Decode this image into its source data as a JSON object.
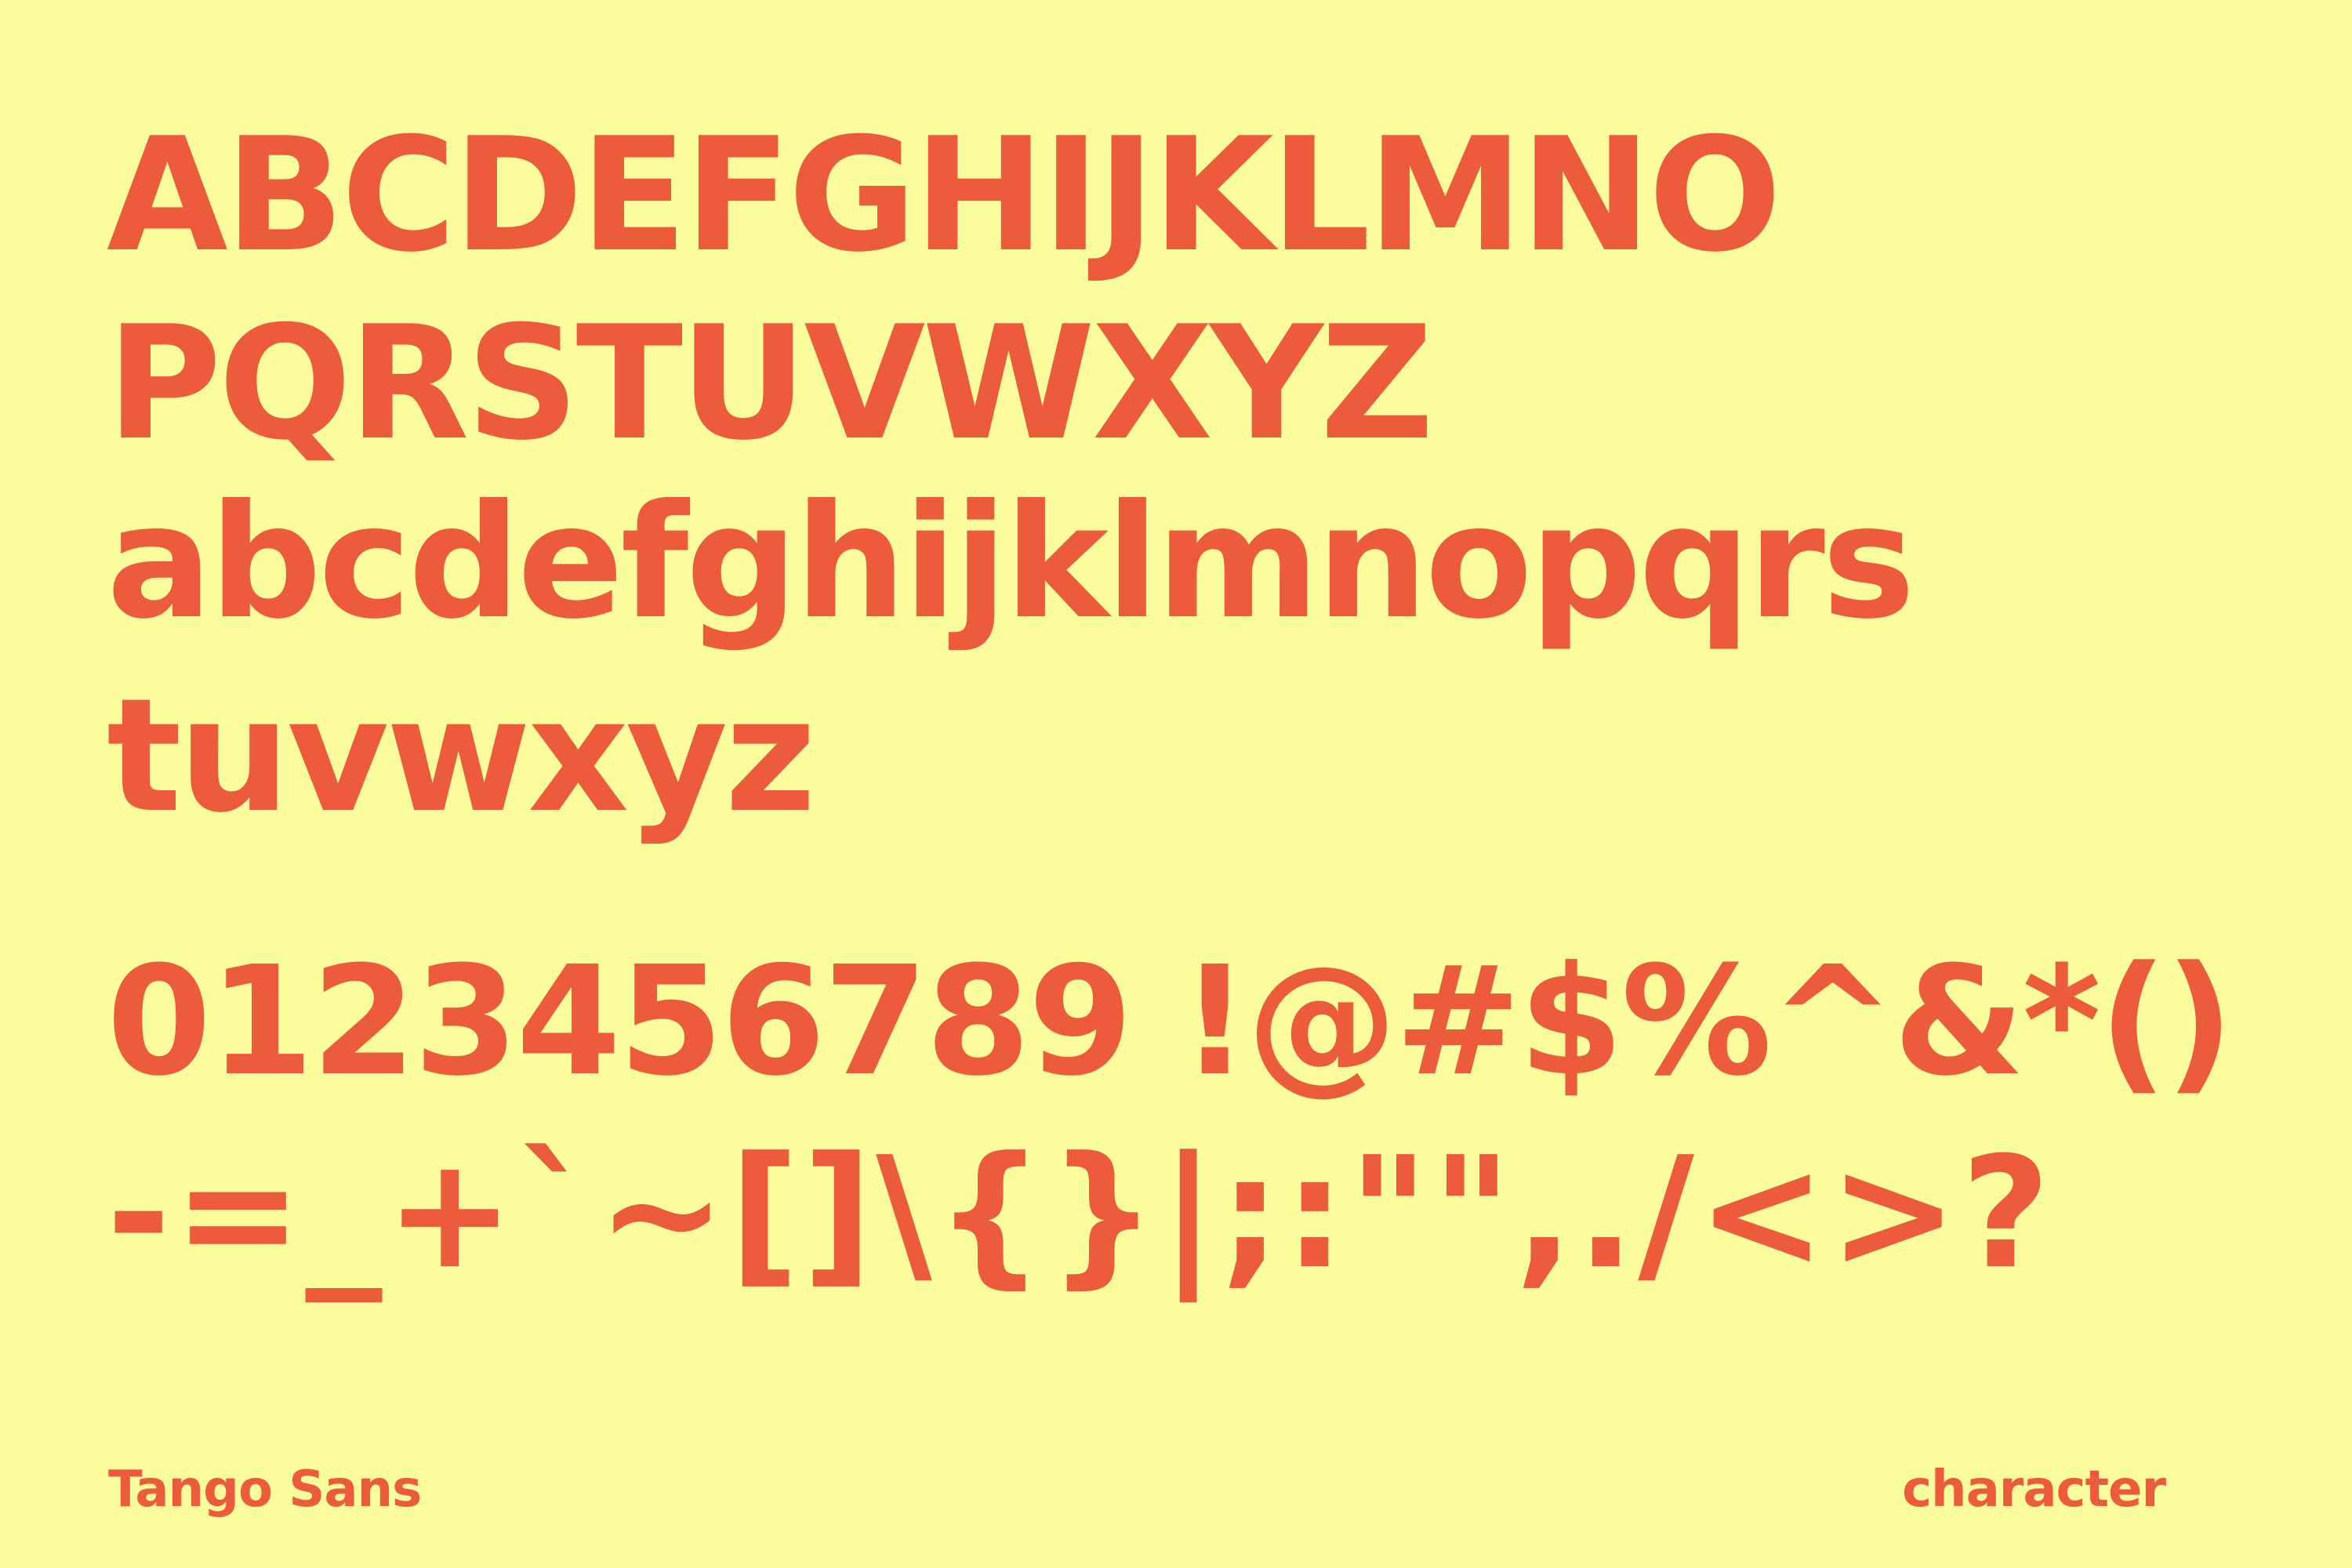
{
  "specimen": {
    "uppercase_line1": "ABCDEFGHIJKLMNO",
    "uppercase_line2": "PQRSTUVWXYZ",
    "lowercase_line1": "abcdefghijklmnopqrs",
    "lowercase_line2": "tuvwxyz",
    "digits_symbols_line": "0123456789 !@#$%^&*()",
    "symbols_line": "-=_+`~[]\\{}|;:\"\",./<>?"
  },
  "footer": {
    "font_name": "Tango Sans",
    "category": "character"
  },
  "colors": {
    "background": "#fbfd9c",
    "text": "#ec5b3c"
  }
}
